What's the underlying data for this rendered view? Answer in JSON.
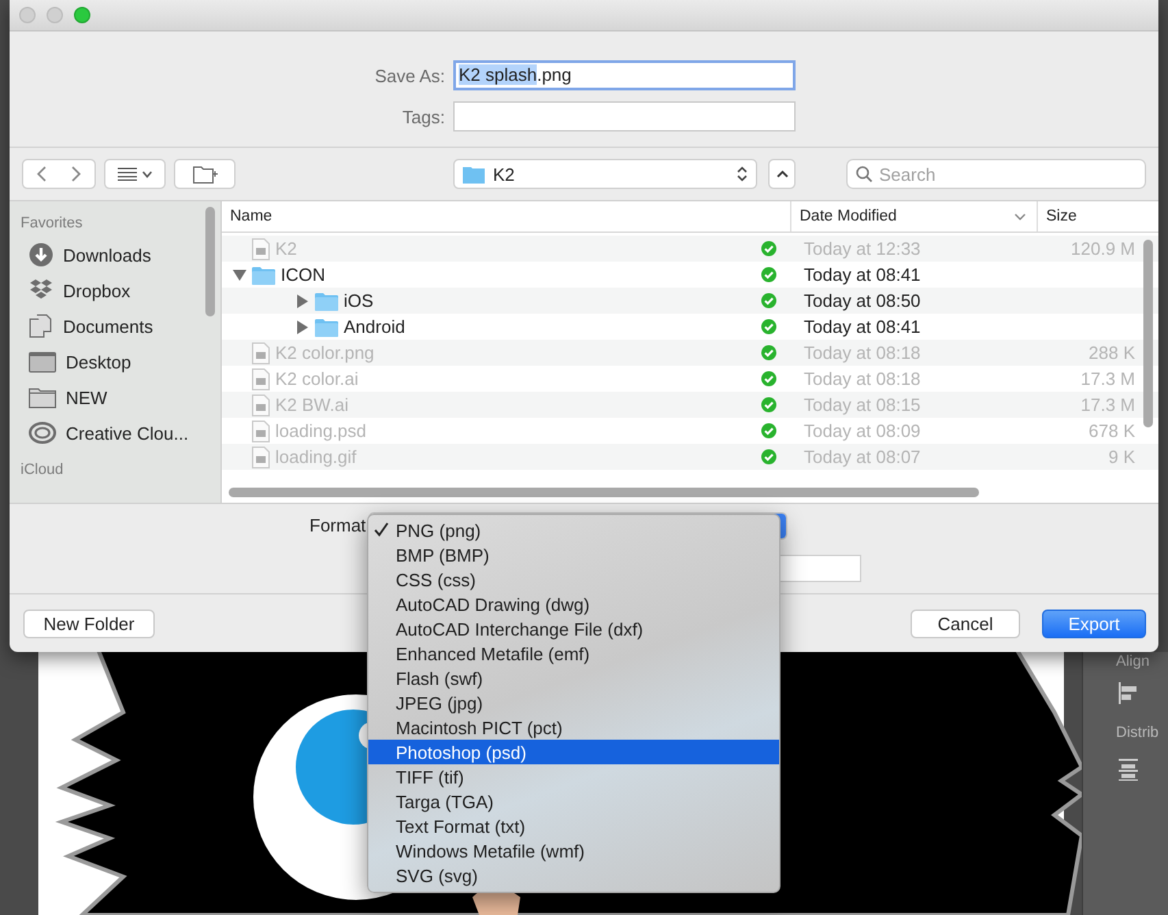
{
  "save_as": {
    "label": "Save As:",
    "value_selected": "K2 splash",
    "value_rest": ".png"
  },
  "tags": {
    "label": "Tags:"
  },
  "toolbar": {
    "location": "K2",
    "search_placeholder": "Search"
  },
  "sidebar": {
    "sections": [
      {
        "title": "Favorites",
        "items": [
          {
            "label": "Downloads",
            "kind": "downloads"
          },
          {
            "label": "Dropbox",
            "kind": "dropbox"
          },
          {
            "label": "Documents",
            "kind": "documents"
          },
          {
            "label": "Desktop",
            "kind": "desktop"
          },
          {
            "label": "NEW",
            "kind": "folder"
          },
          {
            "label": "Creative Clou...",
            "kind": "cloud"
          }
        ]
      },
      {
        "title": "iCloud"
      }
    ]
  },
  "file_list": {
    "columns": [
      "Name",
      "Date Modified",
      "Size"
    ],
    "rows": [
      {
        "name": "K2",
        "kind": "file",
        "disabled": true,
        "date": "Today at 12:33",
        "size": "120.9 M"
      },
      {
        "name": "ICON",
        "kind": "folder",
        "disabled": false,
        "expanded": true,
        "date": "Today at 08:41",
        "children": [
          {
            "name": "iOS",
            "kind": "folder",
            "disabled": false,
            "expanded": false,
            "date": "Today at 08:50"
          },
          {
            "name": "Android",
            "kind": "folder",
            "disabled": false,
            "expanded": false,
            "date": "Today at 08:41"
          }
        ]
      },
      {
        "name": "K2 color.png",
        "kind": "file",
        "disabled": true,
        "date": "Today at 08:18",
        "size": "288 K"
      },
      {
        "name": "K2 color.ai",
        "kind": "file",
        "disabled": true,
        "date": "Today at 08:18",
        "size": "17.3 M"
      },
      {
        "name": "K2 BW.ai",
        "kind": "file",
        "disabled": true,
        "date": "Today at 08:15",
        "size": "17.3 M"
      },
      {
        "name": "loading.psd",
        "kind": "file",
        "disabled": true,
        "date": "Today at 08:09",
        "size": "678 K"
      },
      {
        "name": "loading.gif",
        "kind": "file",
        "disabled": true,
        "date": "Today at 08:07",
        "size": "9 K"
      }
    ]
  },
  "format": {
    "label": "Format",
    "menu": [
      {
        "label": "PNG (png)",
        "checked": true,
        "selected": false
      },
      {
        "label": "BMP (BMP)",
        "checked": false,
        "selected": false
      },
      {
        "label": "CSS (css)",
        "checked": false,
        "selected": false
      },
      {
        "label": "AutoCAD Drawing (dwg)",
        "checked": false,
        "selected": false
      },
      {
        "label": "AutoCAD Interchange File (dxf)",
        "checked": false,
        "selected": false
      },
      {
        "label": "Enhanced Metafile (emf)",
        "checked": false,
        "selected": false
      },
      {
        "label": "Flash (swf)",
        "checked": false,
        "selected": false
      },
      {
        "label": "JPEG (jpg)",
        "checked": false,
        "selected": false
      },
      {
        "label": "Macintosh PICT (pct)",
        "checked": false,
        "selected": false
      },
      {
        "label": "Photoshop (psd)",
        "checked": false,
        "selected": true
      },
      {
        "label": "TIFF (tif)",
        "checked": false,
        "selected": false
      },
      {
        "label": "Targa (TGA)",
        "checked": false,
        "selected": false
      },
      {
        "label": "Text Format (txt)",
        "checked": false,
        "selected": false
      },
      {
        "label": "Windows Metafile (wmf)",
        "checked": false,
        "selected": false
      },
      {
        "label": "SVG (svg)",
        "checked": false,
        "selected": false
      }
    ]
  },
  "buttons": [
    {
      "label": "New Folder",
      "kind": "plain"
    },
    {
      "label": "Cancel",
      "kind": "plain"
    },
    {
      "label": "Export",
      "kind": "default"
    }
  ],
  "side_panel": {
    "labels": [
      "Align",
      "Distrib"
    ]
  }
}
